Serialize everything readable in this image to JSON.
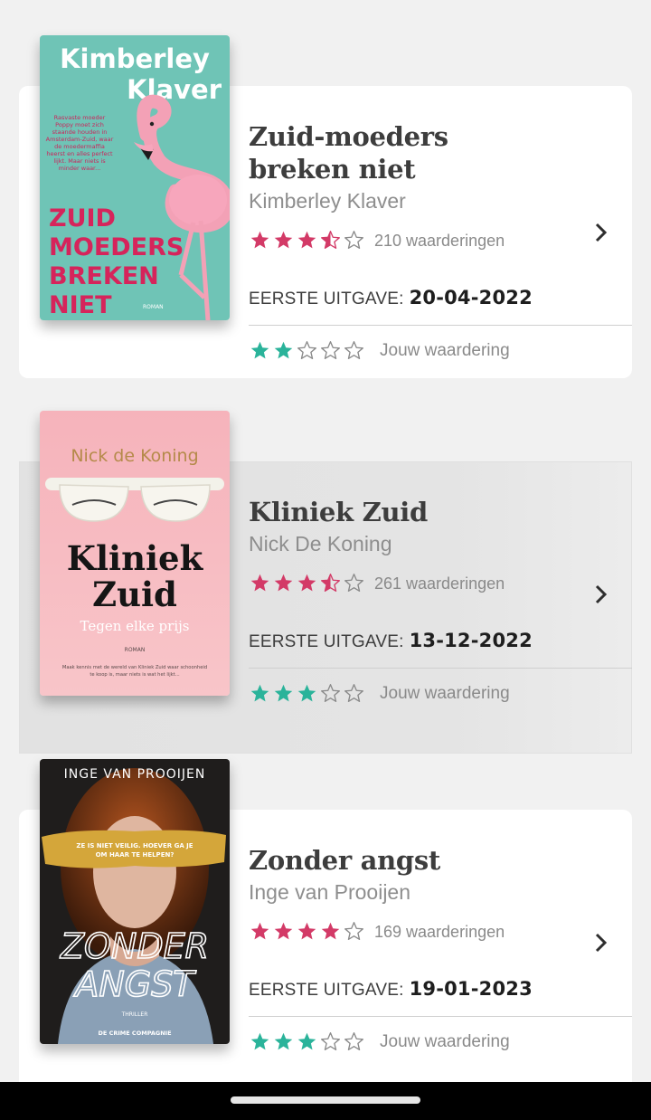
{
  "colors": {
    "rating_star": "#d33a67",
    "user_star": "#2ab39a",
    "empty_star": "#8a8a8a",
    "background": "#f1f1f1"
  },
  "labels": {
    "first_release": "EERSTE UITGAVE:",
    "your_rating": "Jouw waardering"
  },
  "books": [
    {
      "title": "Zuid-moeders breken niet",
      "author": "Kimberley Klaver",
      "rating": 3.5,
      "rating_count": "210 waarderingen",
      "release_date": "20-04-2022",
      "user_rating": 2,
      "cover": {
        "top_text_line1": "Kimberley",
        "top_text_line2": "Klaver",
        "blurb": [
          "Rasvaste moeder",
          "Poppy moet zich",
          "staande houden in",
          "Amsterdam-Zuid, waar",
          "de moedermaffia",
          "heerst en alles perfect",
          "lijkt. Maar niets is",
          "minder waar..."
        ],
        "title_lines": [
          "ZUID",
          "MOEDERS",
          "BREKEN",
          "NIET"
        ],
        "genre": "ROMAN",
        "icon": "flamingo-icon"
      }
    },
    {
      "title": "Kliniek Zuid",
      "author": "Nick De Koning",
      "rating": 3.5,
      "rating_count": "261 waarderingen",
      "release_date": "13-12-2022",
      "user_rating": 3,
      "cover": {
        "top_text_line1": "Nick de Koning",
        "title_lines": [
          "Kliniek",
          "Zuid"
        ],
        "subtitle": "Tegen elke prijs",
        "genre": "ROMAN",
        "blurb": [
          "Maak kennis met de wereld van Kliniek Zuid waar schoonheid",
          "te koop is, maar niets is wat het lijkt..."
        ],
        "icon": "sunglasses-icon"
      }
    },
    {
      "title": "Zonder angst",
      "author": "Inge van Prooijen",
      "rating": 4,
      "rating_count": "169 waarderingen",
      "release_date": "19-01-2023",
      "user_rating": 3,
      "cover": {
        "top_text_line1": "INGE VAN PROOIJEN",
        "tagline_line1": "ZE IS NIET VEILIG. HOEVER GA JE",
        "tagline_line2": "OM HAAR TE HELPEN?",
        "title_lines": [
          "ZONDER",
          "ANGST"
        ],
        "genre": "THRILLER",
        "publisher": "DE CRIME COMPAGNIE",
        "icon": "portrait-icon"
      }
    }
  ]
}
